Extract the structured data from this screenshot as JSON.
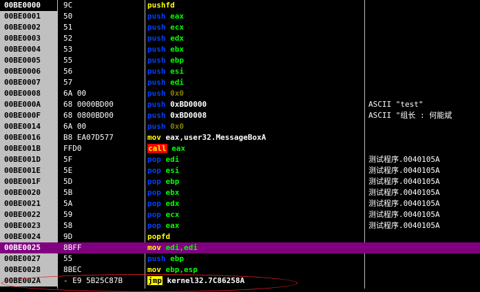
{
  "rows": [
    {
      "addr": "00BE0000",
      "bytes": "9C",
      "mn": "pushfd",
      "mn_color": "yellow",
      "op": "",
      "op_color": "",
      "cm": ""
    },
    {
      "addr": "00BE0001",
      "bytes": "50",
      "mn": "push",
      "mn_color": "blue",
      "op": "eax",
      "op_color": "green",
      "cm": ""
    },
    {
      "addr": "00BE0002",
      "bytes": "51",
      "mn": "push",
      "mn_color": "blue",
      "op": "ecx",
      "op_color": "green",
      "cm": ""
    },
    {
      "addr": "00BE0003",
      "bytes": "52",
      "mn": "push",
      "mn_color": "blue",
      "op": "edx",
      "op_color": "green",
      "cm": ""
    },
    {
      "addr": "00BE0004",
      "bytes": "53",
      "mn": "push",
      "mn_color": "blue",
      "op": "ebx",
      "op_color": "green",
      "cm": ""
    },
    {
      "addr": "00BE0005",
      "bytes": "55",
      "mn": "push",
      "mn_color": "blue",
      "op": "ebp",
      "op_color": "green",
      "cm": ""
    },
    {
      "addr": "00BE0006",
      "bytes": "56",
      "mn": "push",
      "mn_color": "blue",
      "op": "esi",
      "op_color": "green",
      "cm": ""
    },
    {
      "addr": "00BE0007",
      "bytes": "57",
      "mn": "push",
      "mn_color": "blue",
      "op": "edi",
      "op_color": "green",
      "cm": ""
    },
    {
      "addr": "00BE0008",
      "bytes": "6A 00",
      "mn": "push",
      "mn_color": "blue",
      "op": "0x0",
      "op_color": "num",
      "cm": ""
    },
    {
      "addr": "00BE000A",
      "bytes": "68 0000BD00",
      "mn": "push",
      "mn_color": "blue",
      "op": "0xBD0000",
      "op_color": "white",
      "cm": "ASCII \"test\""
    },
    {
      "addr": "00BE000F",
      "bytes": "68 0800BD00",
      "mn": "push",
      "mn_color": "blue",
      "op": "0xBD0008",
      "op_color": "white",
      "cm": "ASCII \"组长 : 何能斌"
    },
    {
      "addr": "00BE0014",
      "bytes": "6A 00",
      "mn": "push",
      "mn_color": "blue",
      "op": "0x0",
      "op_color": "num",
      "cm": ""
    },
    {
      "addr": "00BE0016",
      "bytes": "B8 EA07D577",
      "mn": "mov",
      "mn_color": "yellow",
      "op": "eax,user32.MessageBoxA",
      "op_color": "mixed_mov",
      "cm": ""
    },
    {
      "addr": "00BE001B",
      "bytes": "FFD0",
      "mn": "call",
      "mn_color": "call",
      "op": "eax",
      "op_color": "green",
      "cm": ""
    },
    {
      "addr": "00BE001D",
      "bytes": "5F",
      "mn": "pop",
      "mn_color": "blue",
      "op": "edi",
      "op_color": "green",
      "cm": "测试程序.0040105A"
    },
    {
      "addr": "00BE001E",
      "bytes": "5E",
      "mn": "pop",
      "mn_color": "blue",
      "op": "esi",
      "op_color": "green",
      "cm": "测试程序.0040105A"
    },
    {
      "addr": "00BE001F",
      "bytes": "5D",
      "mn": "pop",
      "mn_color": "blue",
      "op": "ebp",
      "op_color": "green",
      "cm": "测试程序.0040105A"
    },
    {
      "addr": "00BE0020",
      "bytes": "5B",
      "mn": "pop",
      "mn_color": "blue",
      "op": "ebx",
      "op_color": "green",
      "cm": "测试程序.0040105A"
    },
    {
      "addr": "00BE0021",
      "bytes": "5A",
      "mn": "pop",
      "mn_color": "blue",
      "op": "edx",
      "op_color": "green",
      "cm": "测试程序.0040105A"
    },
    {
      "addr": "00BE0022",
      "bytes": "59",
      "mn": "pop",
      "mn_color": "blue",
      "op": "ecx",
      "op_color": "green",
      "cm": "测试程序.0040105A"
    },
    {
      "addr": "00BE0023",
      "bytes": "58",
      "mn": "pop",
      "mn_color": "blue",
      "op": "eax",
      "op_color": "green",
      "cm": "测试程序.0040105A"
    },
    {
      "addr": "00BE0024",
      "bytes": "9D",
      "mn": "popfd",
      "mn_color": "yellow",
      "op": "",
      "op_color": "",
      "cm": ""
    },
    {
      "addr": "00BE0025",
      "bytes": "8BFF",
      "mn": "mov",
      "mn_color": "yellow",
      "op": "edi,edi",
      "op_color": "green",
      "cm": ""
    },
    {
      "addr": "00BE0027",
      "bytes": "55",
      "mn": "push",
      "mn_color": "blue",
      "op": "ebp",
      "op_color": "green",
      "cm": ""
    },
    {
      "addr": "00BE0028",
      "bytes": "8BEC",
      "mn": "mov",
      "mn_color": "yellow",
      "op": "ebp,esp",
      "op_color": "green",
      "cm": ""
    },
    {
      "addr": "00BE002A",
      "bytes": "- E9 5B25C87B",
      "mn": "jmp",
      "mn_color": "jmp",
      "op": "kernel32.7C86258A",
      "op_color": "white",
      "cm": ""
    }
  ],
  "selected_index": 22,
  "colors": {
    "background": "#000000",
    "address_column": "#c0c0c0",
    "selection": "#800080",
    "mnemonic_blue": "#0040ff",
    "mnemonic_yellow": "#ffff00",
    "operand_green": "#00ff00",
    "annotation": "#e02020"
  }
}
